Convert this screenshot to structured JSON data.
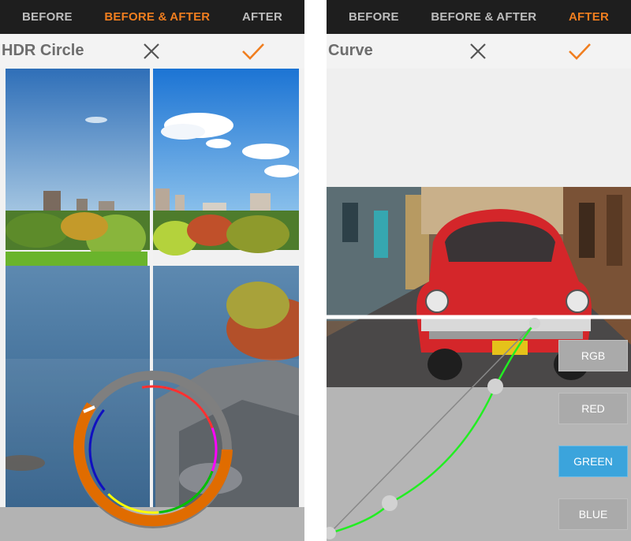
{
  "left_screen": {
    "tabs": [
      {
        "label": "BEFORE",
        "active": false
      },
      {
        "label": "BEFORE & AFTER",
        "active": true
      },
      {
        "label": "AFTER",
        "active": false
      }
    ],
    "title": "HDR Circle",
    "cancel_icon": "close-icon",
    "apply_icon": "checkmark-icon",
    "split_view": true,
    "hdr_circle_colors": [
      "#e06c00",
      "#7f7f7f",
      "#ff3030",
      "#ff00ff",
      "#00c000",
      "#ffff00",
      "#1010c0"
    ]
  },
  "right_screen": {
    "tabs": [
      {
        "label": "BEFORE",
        "active": false
      },
      {
        "label": "BEFORE & AFTER",
        "active": false
      },
      {
        "label": "AFTER",
        "active": true
      }
    ],
    "title": "Curve",
    "cancel_icon": "close-icon",
    "apply_icon": "checkmark-icon",
    "channels": [
      {
        "label": "RGB",
        "active": false
      },
      {
        "label": "RED",
        "active": false
      },
      {
        "label": "GREEN",
        "active": true
      },
      {
        "label": "BLUE",
        "active": false
      }
    ],
    "curve_color": "#22ee22"
  },
  "colors": {
    "accent": "#f07e1f",
    "tabbar_bg": "#1e1e1e",
    "tab_inactive": "#bdbdbd",
    "channel_active": "#3ba4dc",
    "channel_inactive": "#aaaaaa"
  }
}
